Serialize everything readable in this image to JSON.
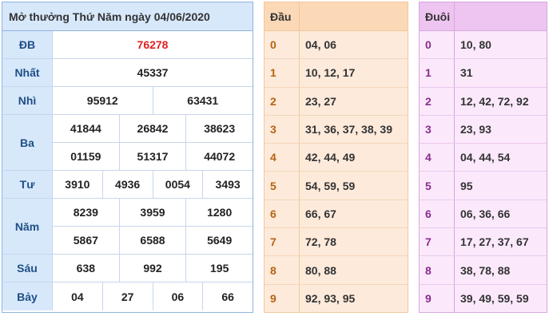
{
  "results": {
    "title": "Mở thưởng Thứ Năm ngày 04/06/2020",
    "prizes": [
      {
        "name": "ĐB",
        "rows": [
          [
            "76278"
          ]
        ]
      },
      {
        "name": "Nhất",
        "rows": [
          [
            "45337"
          ]
        ]
      },
      {
        "name": "Nhì",
        "rows": [
          [
            "95912",
            "63431"
          ]
        ]
      },
      {
        "name": "Ba",
        "rows": [
          [
            "41844",
            "26842",
            "38623"
          ],
          [
            "01159",
            "51317",
            "44072"
          ]
        ]
      },
      {
        "name": "Tư",
        "rows": [
          [
            "3910",
            "4936",
            "0054",
            "3493"
          ]
        ]
      },
      {
        "name": "Năm",
        "rows": [
          [
            "8239",
            "3959",
            "1280"
          ],
          [
            "5867",
            "6588",
            "5649"
          ]
        ]
      },
      {
        "name": "Sáu",
        "rows": [
          [
            "638",
            "992",
            "195"
          ]
        ]
      },
      {
        "name": "Bảy",
        "rows": [
          [
            "04",
            "27",
            "06",
            "66"
          ]
        ]
      }
    ]
  },
  "dau": {
    "header": "Đầu",
    "rows": [
      {
        "digit": "0",
        "values": "04, 06"
      },
      {
        "digit": "1",
        "values": "10, 12, 17"
      },
      {
        "digit": "2",
        "values": "23, 27"
      },
      {
        "digit": "3",
        "values": "31, 36, 37, 38, 39"
      },
      {
        "digit": "4",
        "values": "42, 44, 49"
      },
      {
        "digit": "5",
        "values": "54, 59, 59"
      },
      {
        "digit": "6",
        "values": "66, 67"
      },
      {
        "digit": "7",
        "values": "72, 78"
      },
      {
        "digit": "8",
        "values": "80, 88"
      },
      {
        "digit": "9",
        "values": "92, 93, 95"
      }
    ]
  },
  "duoi": {
    "header": "Đuôi",
    "rows": [
      {
        "digit": "0",
        "values": "10, 80"
      },
      {
        "digit": "1",
        "values": "31"
      },
      {
        "digit": "2",
        "values": "12, 42, 72, 92"
      },
      {
        "digit": "3",
        "values": "23, 93"
      },
      {
        "digit": "4",
        "values": "04, 44, 54"
      },
      {
        "digit": "5",
        "values": "95"
      },
      {
        "digit": "6",
        "values": "06, 36, 66"
      },
      {
        "digit": "7",
        "values": "17, 27, 37, 67"
      },
      {
        "digit": "8",
        "values": "38, 78, 88"
      },
      {
        "digit": "9",
        "values": "39, 49, 59, 59"
      }
    ]
  },
  "colors": {
    "special_prize": "#e02020",
    "results_header": "#d7e8fb",
    "dau_header": "#fbd9b7",
    "duoi_header": "#eec4f0"
  }
}
